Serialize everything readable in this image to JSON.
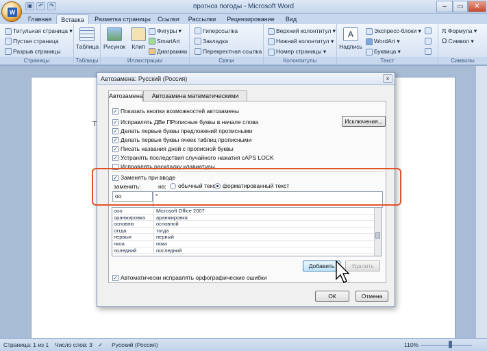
{
  "window": {
    "title": "прогноз погоды - Microsoft Word",
    "minimize": "–",
    "restore": "▭",
    "close": "✕"
  },
  "quick_access": [
    "save",
    "undo",
    "redo"
  ],
  "ribbon_tabs": [
    "Главная",
    "Вставка",
    "Разметка страницы",
    "Ссылки",
    "Рассылки",
    "Рецензирование",
    "Вид"
  ],
  "active_tab": "Вставка",
  "ribbon": {
    "pages": {
      "label": "Страницы",
      "items": [
        "Титульная страница ▾",
        "Пустая страница",
        "Разрыв страницы"
      ]
    },
    "tables": {
      "label": "Таблицы",
      "table": "Таблица"
    },
    "illustrations": {
      "label": "Иллюстрации",
      "picture": "Рисунок",
      "clip": "Клип",
      "shapes": "Фигуры ▾",
      "smartart": "SmartArt",
      "chart": "Диаграмма"
    },
    "links": {
      "label": "Связи",
      "items": [
        "Гиперссылка",
        "Закладка",
        "Перекрестная ссылка"
      ]
    },
    "header_footer": {
      "label": "Колонтитулы",
      "items": [
        "Верхний колонтитул ▾",
        "Нижний колонтитул ▾",
        "Номер страницы ▾"
      ]
    },
    "text": {
      "label": "Текст",
      "textbox": "Надпись",
      "items": [
        "Экспресс-блоки ▾",
        "WordArt ▾",
        "Буквица ▾"
      ]
    },
    "symbols": {
      "label": "Символы",
      "items": [
        "Формула ▾",
        "Символ ▾"
      ]
    }
  },
  "document": {
    "visible_text": "Те"
  },
  "dialog": {
    "title": "Автозамена: Русский (Россия)",
    "close": "x",
    "tabs": [
      "Автозамена",
      "Автозамена математическими символами"
    ],
    "options": [
      {
        "label": "Показать кнопки возможностей автозамены",
        "checked": true
      },
      {
        "label": "Исправлять ДВе ПРописные буквы в начале слова",
        "checked": true
      },
      {
        "label": "Делать первые буквы предложений прописными",
        "checked": true
      },
      {
        "label": "Делать первые буквы ячеек таблиц прописными",
        "checked": true
      },
      {
        "label": "Писать названия дней с прописной буквы",
        "checked": true
      },
      {
        "label": "Устранять последствия случайного нажатия cAPS LOCK",
        "checked": true
      },
      {
        "label": "Исправлять раскладку клавиатуры",
        "checked": false
      }
    ],
    "exceptions_button": "Исключения...",
    "replace_as_you_type": {
      "label": "Заменять при вводе",
      "checked": true
    },
    "replace_label": "заменить:",
    "with_label": "на:",
    "plain_text": "обычный текст",
    "formatted_text": "форматированный текст",
    "replace_value": "oo",
    "with_value": "°",
    "list": [
      [
        "ooo",
        "Microsoft Office 2007"
      ],
      [
        "оранжировка",
        "аранжировка"
      ],
      [
        "основню",
        "основной"
      ],
      [
        "отгда",
        "тогда"
      ],
      [
        "первыи",
        "первый"
      ],
      [
        "пкоа",
        "пока"
      ],
      [
        "поледний",
        "последний"
      ]
    ],
    "add_button": "Добавить",
    "delete_button": "Удалить",
    "spell_option": {
      "label": "Автоматически исправлять орфографические ошибки",
      "checked": true
    },
    "ok": "ОК",
    "cancel": "Отмена"
  },
  "status_bar": {
    "page": "Страница: 1 из 1",
    "words": "Число слов: 3",
    "language": "Русский (Россия)",
    "zoom": "110%"
  }
}
